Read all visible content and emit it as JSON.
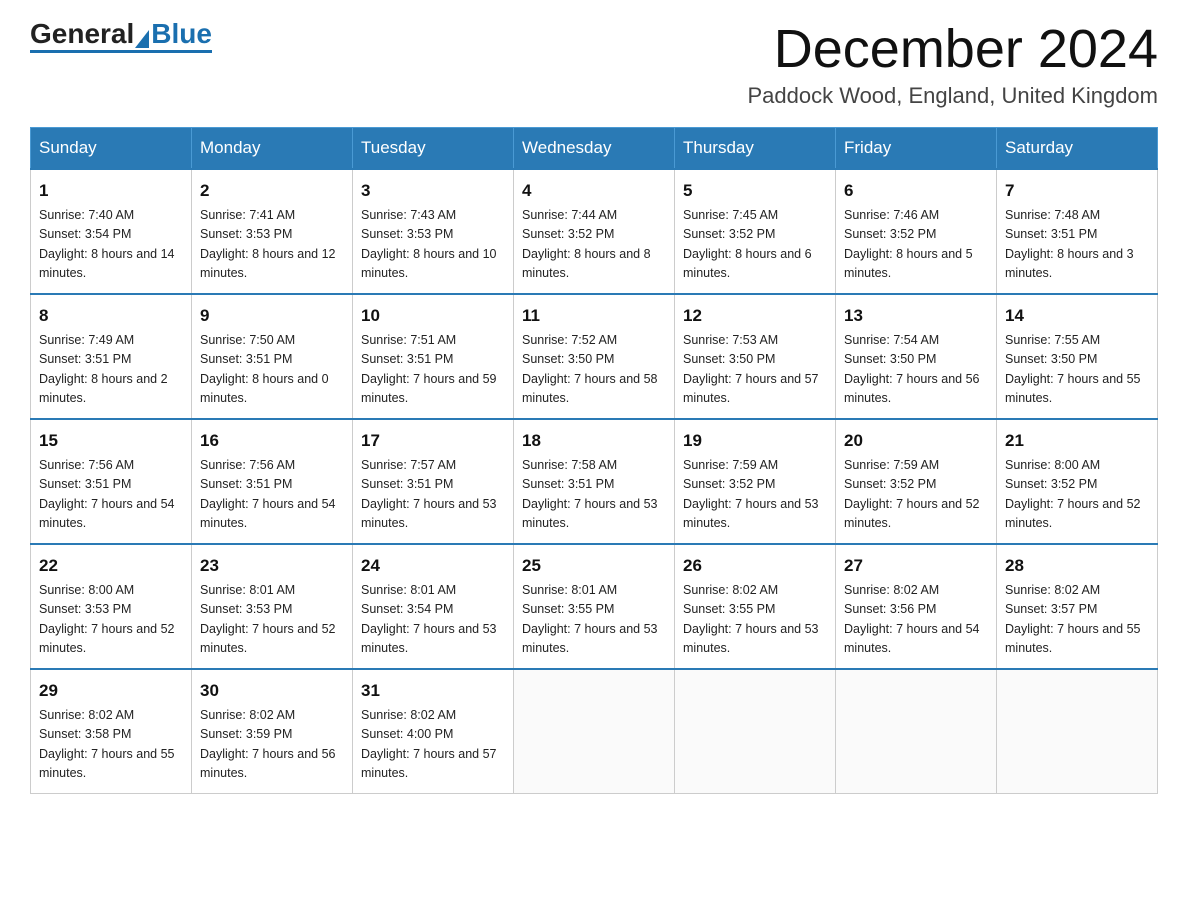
{
  "header": {
    "logo_general": "General",
    "logo_blue": "Blue",
    "month_title": "December 2024",
    "location": "Paddock Wood, England, United Kingdom"
  },
  "weekdays": [
    "Sunday",
    "Monday",
    "Tuesday",
    "Wednesday",
    "Thursday",
    "Friday",
    "Saturday"
  ],
  "weeks": [
    [
      {
        "day": "1",
        "sunrise": "7:40 AM",
        "sunset": "3:54 PM",
        "daylight": "8 hours and 14 minutes."
      },
      {
        "day": "2",
        "sunrise": "7:41 AM",
        "sunset": "3:53 PM",
        "daylight": "8 hours and 12 minutes."
      },
      {
        "day": "3",
        "sunrise": "7:43 AM",
        "sunset": "3:53 PM",
        "daylight": "8 hours and 10 minutes."
      },
      {
        "day": "4",
        "sunrise": "7:44 AM",
        "sunset": "3:52 PM",
        "daylight": "8 hours and 8 minutes."
      },
      {
        "day": "5",
        "sunrise": "7:45 AM",
        "sunset": "3:52 PM",
        "daylight": "8 hours and 6 minutes."
      },
      {
        "day": "6",
        "sunrise": "7:46 AM",
        "sunset": "3:52 PM",
        "daylight": "8 hours and 5 minutes."
      },
      {
        "day": "7",
        "sunrise": "7:48 AM",
        "sunset": "3:51 PM",
        "daylight": "8 hours and 3 minutes."
      }
    ],
    [
      {
        "day": "8",
        "sunrise": "7:49 AM",
        "sunset": "3:51 PM",
        "daylight": "8 hours and 2 minutes."
      },
      {
        "day": "9",
        "sunrise": "7:50 AM",
        "sunset": "3:51 PM",
        "daylight": "8 hours and 0 minutes."
      },
      {
        "day": "10",
        "sunrise": "7:51 AM",
        "sunset": "3:51 PM",
        "daylight": "7 hours and 59 minutes."
      },
      {
        "day": "11",
        "sunrise": "7:52 AM",
        "sunset": "3:50 PM",
        "daylight": "7 hours and 58 minutes."
      },
      {
        "day": "12",
        "sunrise": "7:53 AM",
        "sunset": "3:50 PM",
        "daylight": "7 hours and 57 minutes."
      },
      {
        "day": "13",
        "sunrise": "7:54 AM",
        "sunset": "3:50 PM",
        "daylight": "7 hours and 56 minutes."
      },
      {
        "day": "14",
        "sunrise": "7:55 AM",
        "sunset": "3:50 PM",
        "daylight": "7 hours and 55 minutes."
      }
    ],
    [
      {
        "day": "15",
        "sunrise": "7:56 AM",
        "sunset": "3:51 PM",
        "daylight": "7 hours and 54 minutes."
      },
      {
        "day": "16",
        "sunrise": "7:56 AM",
        "sunset": "3:51 PM",
        "daylight": "7 hours and 54 minutes."
      },
      {
        "day": "17",
        "sunrise": "7:57 AM",
        "sunset": "3:51 PM",
        "daylight": "7 hours and 53 minutes."
      },
      {
        "day": "18",
        "sunrise": "7:58 AM",
        "sunset": "3:51 PM",
        "daylight": "7 hours and 53 minutes."
      },
      {
        "day": "19",
        "sunrise": "7:59 AM",
        "sunset": "3:52 PM",
        "daylight": "7 hours and 53 minutes."
      },
      {
        "day": "20",
        "sunrise": "7:59 AM",
        "sunset": "3:52 PM",
        "daylight": "7 hours and 52 minutes."
      },
      {
        "day": "21",
        "sunrise": "8:00 AM",
        "sunset": "3:52 PM",
        "daylight": "7 hours and 52 minutes."
      }
    ],
    [
      {
        "day": "22",
        "sunrise": "8:00 AM",
        "sunset": "3:53 PM",
        "daylight": "7 hours and 52 minutes."
      },
      {
        "day": "23",
        "sunrise": "8:01 AM",
        "sunset": "3:53 PM",
        "daylight": "7 hours and 52 minutes."
      },
      {
        "day": "24",
        "sunrise": "8:01 AM",
        "sunset": "3:54 PM",
        "daylight": "7 hours and 53 minutes."
      },
      {
        "day": "25",
        "sunrise": "8:01 AM",
        "sunset": "3:55 PM",
        "daylight": "7 hours and 53 minutes."
      },
      {
        "day": "26",
        "sunrise": "8:02 AM",
        "sunset": "3:55 PM",
        "daylight": "7 hours and 53 minutes."
      },
      {
        "day": "27",
        "sunrise": "8:02 AM",
        "sunset": "3:56 PM",
        "daylight": "7 hours and 54 minutes."
      },
      {
        "day": "28",
        "sunrise": "8:02 AM",
        "sunset": "3:57 PM",
        "daylight": "7 hours and 55 minutes."
      }
    ],
    [
      {
        "day": "29",
        "sunrise": "8:02 AM",
        "sunset": "3:58 PM",
        "daylight": "7 hours and 55 minutes."
      },
      {
        "day": "30",
        "sunrise": "8:02 AM",
        "sunset": "3:59 PM",
        "daylight": "7 hours and 56 minutes."
      },
      {
        "day": "31",
        "sunrise": "8:02 AM",
        "sunset": "4:00 PM",
        "daylight": "7 hours and 57 minutes."
      },
      null,
      null,
      null,
      null
    ]
  ]
}
